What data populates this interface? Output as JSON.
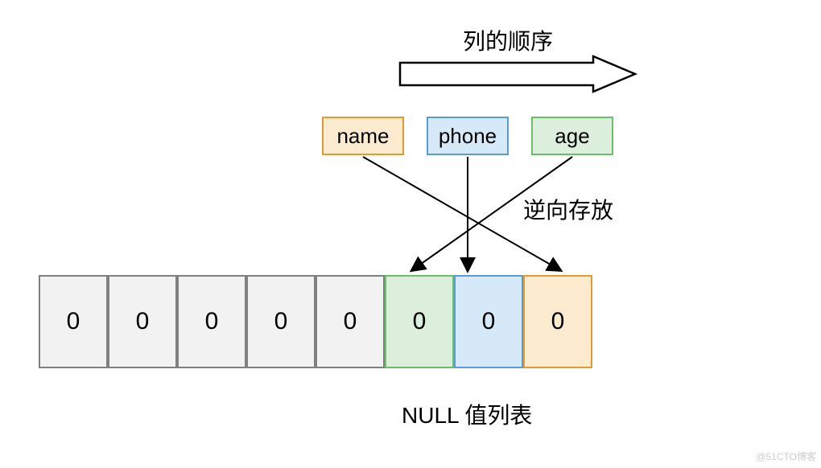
{
  "labels": {
    "column_order": "列的顺序",
    "reverse_store": "逆向存放",
    "null_list": "NULL 值列表"
  },
  "columns": {
    "name": {
      "label": "name",
      "fill": "#fdebd0",
      "stroke": "#e59a2d"
    },
    "phone": {
      "label": "phone",
      "fill": "#d6e9f8",
      "stroke": "#5a9bd4"
    },
    "age": {
      "label": "age",
      "fill": "#dcefdc",
      "stroke": "#6bbf6b"
    }
  },
  "bits": {
    "b0": {
      "value": "0",
      "fill": "#f2f2f2",
      "stroke": "#808080"
    },
    "b1": {
      "value": "0",
      "fill": "#f2f2f2",
      "stroke": "#808080"
    },
    "b2": {
      "value": "0",
      "fill": "#f2f2f2",
      "stroke": "#808080"
    },
    "b3": {
      "value": "0",
      "fill": "#f2f2f2",
      "stroke": "#808080"
    },
    "b4": {
      "value": "0",
      "fill": "#f2f2f2",
      "stroke": "#808080"
    },
    "b5": {
      "value": "0",
      "fill": "#dcefdc",
      "stroke": "#6bbf6b"
    },
    "b6": {
      "value": "0",
      "fill": "#d6e9f8",
      "stroke": "#5a9bd4"
    },
    "b7": {
      "value": "0",
      "fill": "#fdebd0",
      "stroke": "#e59a2d"
    }
  },
  "watermark": "@51CTO博客"
}
